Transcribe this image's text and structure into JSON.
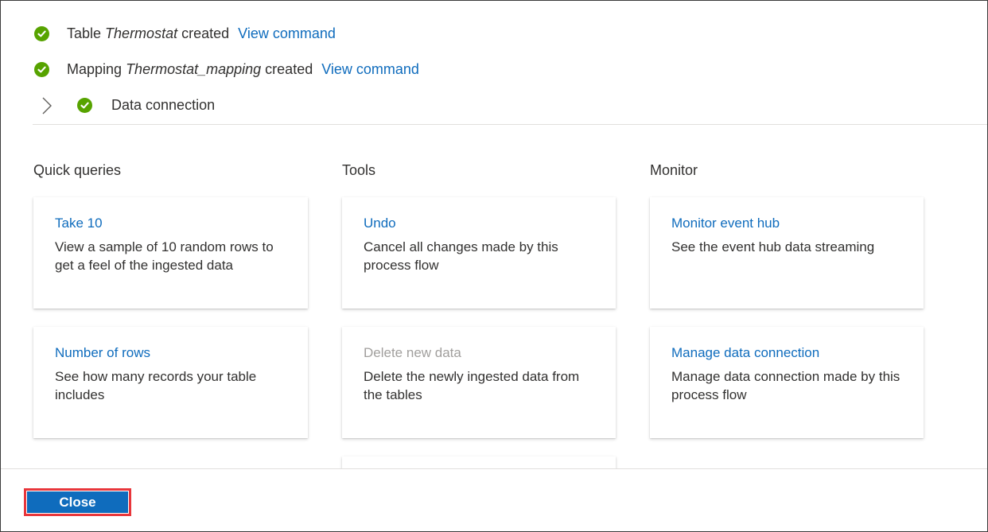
{
  "status": {
    "table": {
      "prefix": "Table",
      "name": "Thermostat",
      "suffix": "created",
      "link": "View command"
    },
    "mapping": {
      "prefix": "Mapping",
      "name": "Thermostat_mapping",
      "suffix": "created",
      "link": "View command"
    },
    "data_connection": {
      "label": "Data connection"
    }
  },
  "sections": {
    "quick_queries": {
      "title": "Quick queries",
      "cards": [
        {
          "title": "Take 10",
          "description": "View a sample of 10 random rows to get a feel of the ingested data"
        },
        {
          "title": "Number of rows",
          "description": "See how many records your table includes"
        }
      ]
    },
    "tools": {
      "title": "Tools",
      "cards": [
        {
          "title": "Undo",
          "description": "Cancel all changes made by this process flow"
        },
        {
          "title": "Delete new data",
          "description": "Delete the newly ingested data from the tables",
          "disabled": true
        }
      ]
    },
    "monitor": {
      "title": "Monitor",
      "cards": [
        {
          "title": "Monitor event hub",
          "description": "See the event hub data streaming"
        },
        {
          "title": "Manage data connection",
          "description": "Manage data connection made by this process flow"
        }
      ]
    }
  },
  "footer": {
    "close_label": "Close"
  },
  "icons": {
    "check": "check-circle-icon",
    "expand": "chevron-right-icon"
  },
  "colors": {
    "link": "#0f6cbd",
    "success": "#57a300",
    "primary_button": "#0f6cbd",
    "highlight_outline": "#e8363b",
    "disabled_text": "#a19f9d"
  }
}
